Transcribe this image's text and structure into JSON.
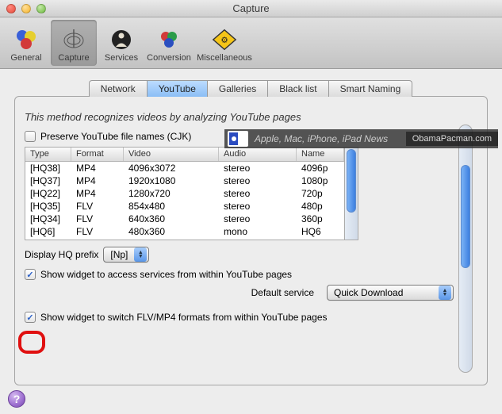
{
  "title": "Capture",
  "toolbar": [
    {
      "id": "general",
      "label": "General"
    },
    {
      "id": "capture",
      "label": "Capture"
    },
    {
      "id": "services",
      "label": "Services"
    },
    {
      "id": "conversion",
      "label": "Conversion"
    },
    {
      "id": "miscellaneous",
      "label": "Miscellaneous"
    }
  ],
  "tabs": [
    "Network",
    "YouTube",
    "Galleries",
    "Black list",
    "Smart Naming"
  ],
  "activeTab": "YouTube",
  "methodText": "This method recognizes videos by analyzing YouTube pages",
  "preserveLabel": "Preserve YouTube file names (CJK)",
  "tableHeaders": {
    "type": "Type",
    "format": "Format",
    "video": "Video",
    "audio": "Audio",
    "name": "Name"
  },
  "tableRows": [
    {
      "type": "[HQ38]",
      "format": "MP4",
      "video": "4096x3072",
      "audio": "stereo",
      "name": "4096p"
    },
    {
      "type": "[HQ37]",
      "format": "MP4",
      "video": "1920x1080",
      "audio": "stereo",
      "name": "1080p"
    },
    {
      "type": "[HQ22]",
      "format": "MP4",
      "video": "1280x720",
      "audio": "stereo",
      "name": "720p"
    },
    {
      "type": "[HQ35]",
      "format": "FLV",
      "video": "854x480",
      "audio": "stereo",
      "name": "480p"
    },
    {
      "type": "[HQ34]",
      "format": "FLV",
      "video": "640x360",
      "audio": "stereo",
      "name": "360p"
    },
    {
      "type": "[HQ6]",
      "format": "FLV",
      "video": "480x360",
      "audio": "mono",
      "name": "HQ6"
    }
  ],
  "displayPrefixLabel": "Display HQ prefix",
  "displayPrefixValue": "[Np]",
  "showWidgetAccessLabel": "Show widget to access services from within YouTube pages",
  "defaultServiceLabel": "Default service",
  "defaultServiceValue": "Quick Download",
  "showWidgetSwitchLabel": "Show widget to switch FLV/MP4 formats from within YouTube pages",
  "overlay": {
    "text": "Apple, Mac, iPhone, iPad News",
    "source": "ObamaPacman.com"
  },
  "help": "?"
}
